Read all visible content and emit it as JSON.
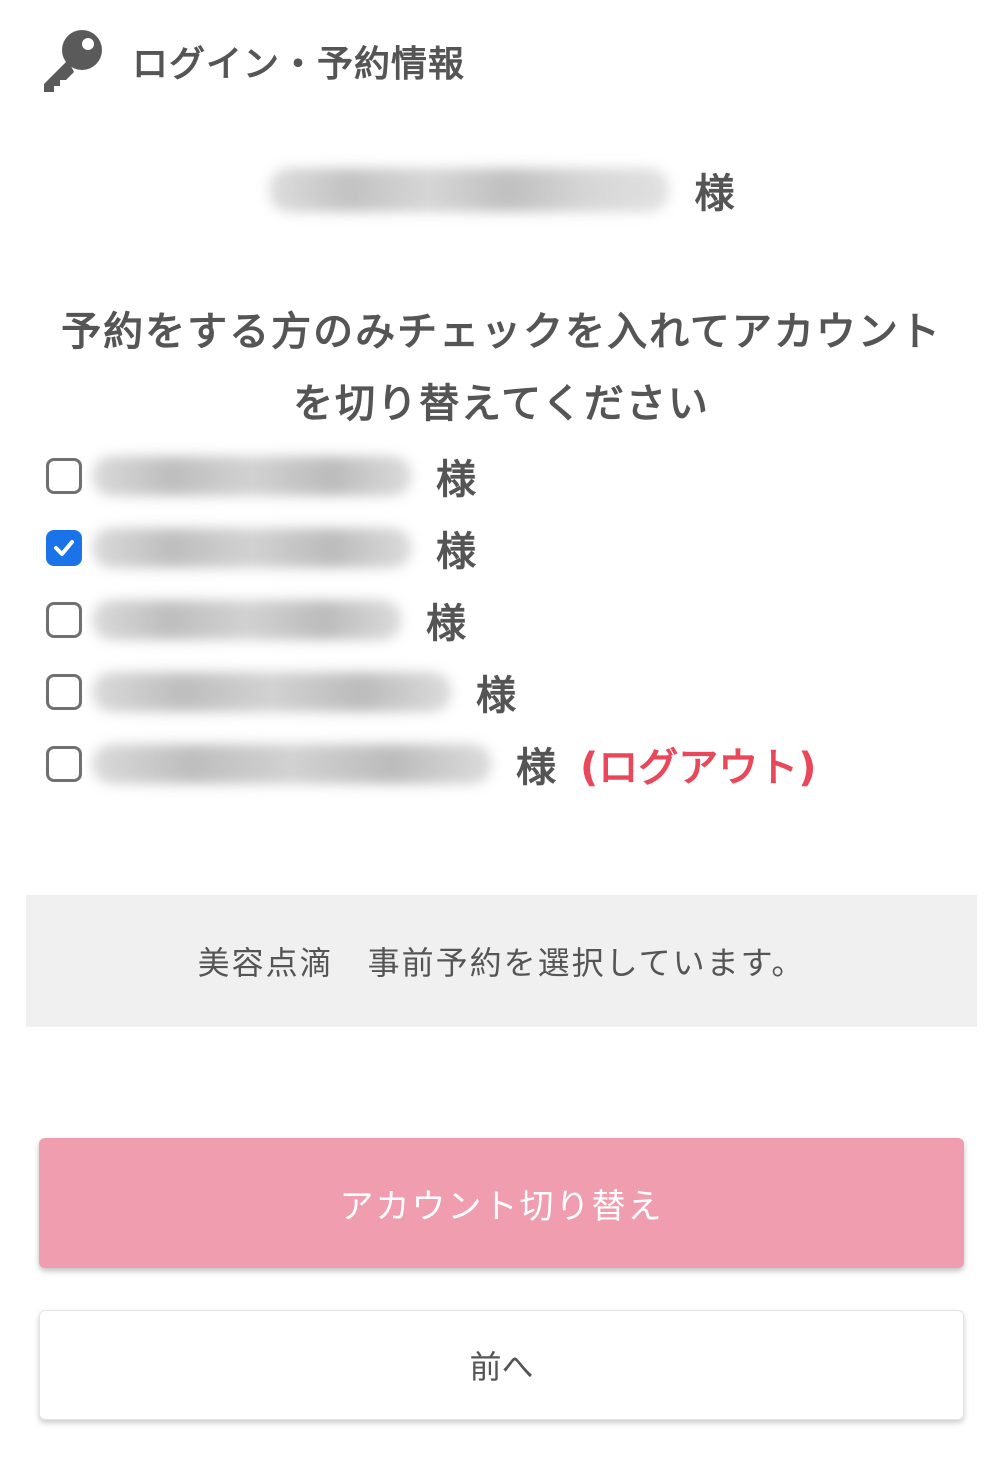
{
  "header": {
    "icon": "key-icon",
    "title": "ログイン・予約情報"
  },
  "user": {
    "name": "",
    "honorific": "様"
  },
  "instruction": {
    "line1": "予約をする方のみチェックを入れてアカウント",
    "line2": "を切り替えてください"
  },
  "accounts": [
    {
      "checked": false,
      "honorific": "様",
      "logout": ""
    },
    {
      "checked": true,
      "honorific": "様",
      "logout": ""
    },
    {
      "checked": false,
      "honorific": "様",
      "logout": ""
    },
    {
      "checked": false,
      "honorific": "様",
      "logout": ""
    },
    {
      "checked": false,
      "honorific": "様",
      "logout": "(ログアウト)"
    }
  ],
  "notice": {
    "text": "美容点滴　事前予約を選択しています。"
  },
  "buttons": {
    "switch_account": "アカウント切り替え",
    "back": "前へ"
  },
  "colors": {
    "primary_button": "#f09db0",
    "logout_text": "#e8485a",
    "checkbox_checked": "#1a73e8",
    "notice_background": "#f0f0f0",
    "text": "#555555"
  }
}
